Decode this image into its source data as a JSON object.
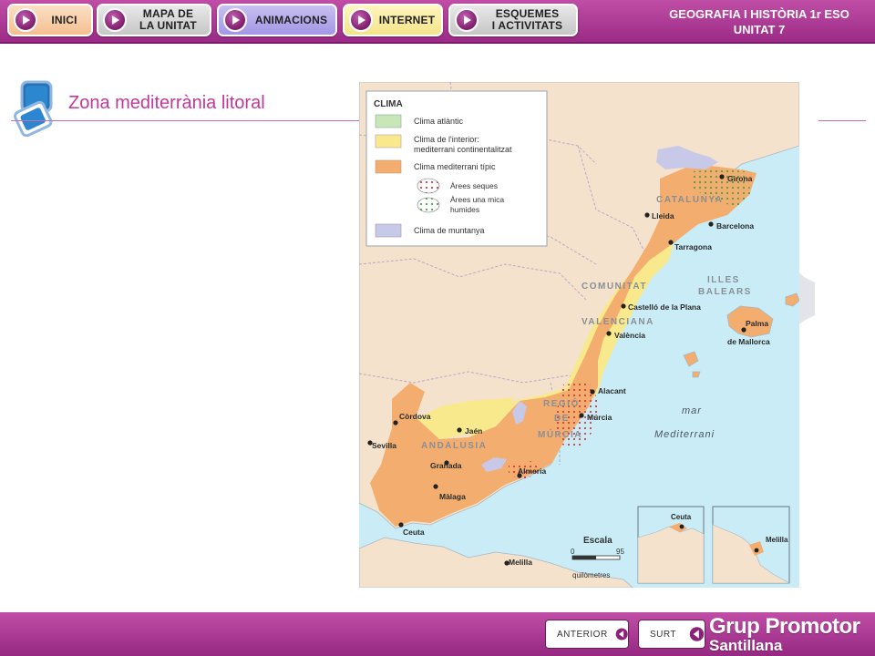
{
  "nav": {
    "items": [
      {
        "label": "INICI"
      },
      {
        "label": "MAPA DE\nLA UNITAT"
      },
      {
        "label": "ANIMACIONS"
      },
      {
        "label": "INTERNET"
      },
      {
        "label": "ESQUEMES\nI ACTIVITATS"
      }
    ],
    "course_line1": "GEOGRAFIA I HISTÒRIA 1r ESO",
    "course_line2": "UNITAT 7"
  },
  "slide": {
    "title": "Zona mediterrània litoral"
  },
  "map": {
    "legend_title": "CLIMA",
    "legend": [
      {
        "label": "Clima atlàntic",
        "color": "#c9e6b8"
      },
      {
        "label": "Clima de l'interior:",
        "label2": "mediterrani continentalitzat",
        "color": "#f8e98c"
      },
      {
        "label": "Clima mediterrani típic",
        "color": "#f3ad6e"
      },
      {
        "label": "Àrees seques",
        "color": "#d93a3a"
      },
      {
        "label": "Àrees una mica",
        "label2": "humides",
        "color": "#3fa84b"
      },
      {
        "label": "Clima de muntanya",
        "color": "#c8c9e8"
      }
    ],
    "regions": [
      {
        "label": "CATALUNYA"
      },
      {
        "label": "ILLES"
      },
      {
        "label": "BALEARS"
      },
      {
        "label": "COMUNITAT"
      },
      {
        "label": "VALENCIANA"
      },
      {
        "label": "REGIÓ"
      },
      {
        "label": "DE"
      },
      {
        "label": "MÚRCIA"
      },
      {
        "label": "ANDALUSIA"
      }
    ],
    "cities": [
      {
        "label": "Girona"
      },
      {
        "label": "Lleida"
      },
      {
        "label": "Barcelona"
      },
      {
        "label": "Tarragona"
      },
      {
        "label": "Castelló de la Plana"
      },
      {
        "label": "València"
      },
      {
        "label": "Palma"
      },
      {
        "label": "de Mallorca"
      },
      {
        "label": "Alacant"
      },
      {
        "label": "Múrcia"
      },
      {
        "label": "Almeria"
      },
      {
        "label": "Còrdova"
      },
      {
        "label": "Jaén"
      },
      {
        "label": "Sevilla"
      },
      {
        "label": "Granada"
      },
      {
        "label": "Màlaga"
      },
      {
        "label": "Ceuta"
      },
      {
        "label": "Melilla"
      }
    ],
    "sea_1": "mar",
    "sea_2": "Mediterrani",
    "scale_title": "Escala",
    "scale_min": "0",
    "scale_max": "95",
    "scale_unit": "quilòmetres",
    "inset_1": "Ceuta",
    "inset_2": "Melilla"
  },
  "footer": {
    "prev_label": "ANTERIOR",
    "exit_label": "SURT",
    "brand_1": "Grup Promotor",
    "brand_2": "Santillana"
  },
  "colors": {
    "brand": "#a8348f",
    "title": "#c0399a",
    "sea": "#c9ecf6",
    "land": "#f4e2cc"
  }
}
